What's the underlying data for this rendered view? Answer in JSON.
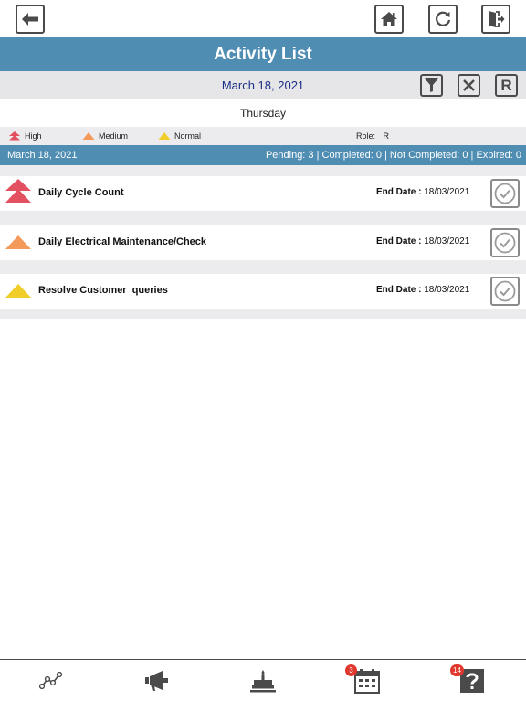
{
  "app": {
    "title": "Activity List"
  },
  "header": {
    "back_icon": "back-arrow-icon",
    "home_icon": "home-icon",
    "refresh_icon": "refresh-icon",
    "logout_icon": "logout-icon"
  },
  "date_bar": {
    "date": "March 18, 2021",
    "filter_icon": "filter-icon",
    "clear_icon": "clear-x-icon",
    "reset_label": "R"
  },
  "day": "Thursday",
  "legend": {
    "items": [
      {
        "label": "High",
        "color": "#e3505f"
      },
      {
        "label": "Medium",
        "color": "#f39a5a"
      },
      {
        "label": "Normal",
        "color": "#f1cd2a"
      }
    ],
    "role_label": "Role:",
    "role_value": "R"
  },
  "summary": {
    "date": "March 18, 2021",
    "stats": "Pending: 3 | Completed: 0 | Not Completed: 0 | Expired: 0"
  },
  "activities": [
    {
      "name": "Daily Cycle Count",
      "priority": "High",
      "end_label": "End Date :",
      "end_date": "18/03/2021"
    },
    {
      "name": "Daily Electrical Maintenance/Check",
      "priority": "Medium",
      "end_label": "End Date :",
      "end_date": "18/03/2021"
    },
    {
      "name": "Resolve Customer  queries",
      "priority": "Normal",
      "end_label": "End Date :",
      "end_date": "18/03/2021"
    }
  ],
  "bottom_nav": {
    "items": [
      {
        "icon": "chart-line-icon"
      },
      {
        "icon": "megaphone-icon"
      },
      {
        "icon": "birthday-cake-icon"
      },
      {
        "icon": "calendar-icon",
        "badge": "3"
      },
      {
        "icon": "help-icon",
        "badge": "14"
      }
    ]
  },
  "colors": {
    "primary": "#4f8db3",
    "date_text": "#1c2f86",
    "badge": "#e0382d"
  }
}
